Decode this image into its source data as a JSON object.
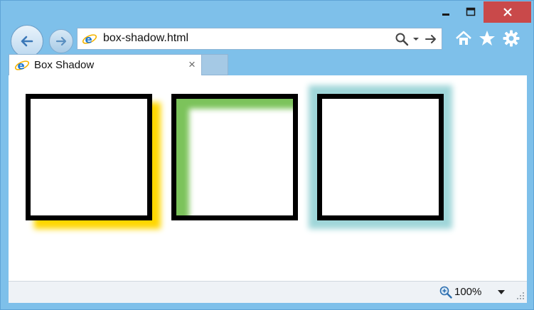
{
  "colors": {
    "frame": "#7ec0ea",
    "close_button": "#c9494a",
    "shadow_yellow": "#ffd700",
    "shadow_green": "#7cc35b",
    "shadow_teal": "#9fd6d9",
    "box_border": "#000000"
  },
  "window_controls": {
    "minimize_icon": "minimize-icon",
    "maximize_icon": "maximize-icon",
    "close_icon": "close-icon"
  },
  "nav": {
    "back_icon": "back-arrow-icon",
    "forward_icon": "forward-arrow-icon"
  },
  "address_bar": {
    "url": "box-shadow.html",
    "site_icon": "ie-logo-icon",
    "search_icon": "search-icon",
    "dropdown_icon": "chevron-down-icon",
    "go_icon": "go-arrow-icon"
  },
  "toolbar": {
    "home_icon": "home-icon",
    "favorites_icon": "star-icon",
    "tools_icon": "gear-icon"
  },
  "tabs": [
    {
      "title": "Box Shadow",
      "close_label": "×",
      "active": true
    }
  ],
  "page": {
    "boxes": [
      {
        "name": "yellow-drop-shadow-box",
        "shadow_color": "#ffd700"
      },
      {
        "name": "green-inset-shadow-box",
        "shadow_color": "#7cc35b"
      },
      {
        "name": "teal-glow-shadow-box",
        "shadow_color": "#9fd6d9"
      }
    ]
  },
  "status_bar": {
    "zoom_label": "100%",
    "zoom_icon": "zoom-magnifier-icon",
    "dropdown_icon": "chevron-down-icon"
  }
}
